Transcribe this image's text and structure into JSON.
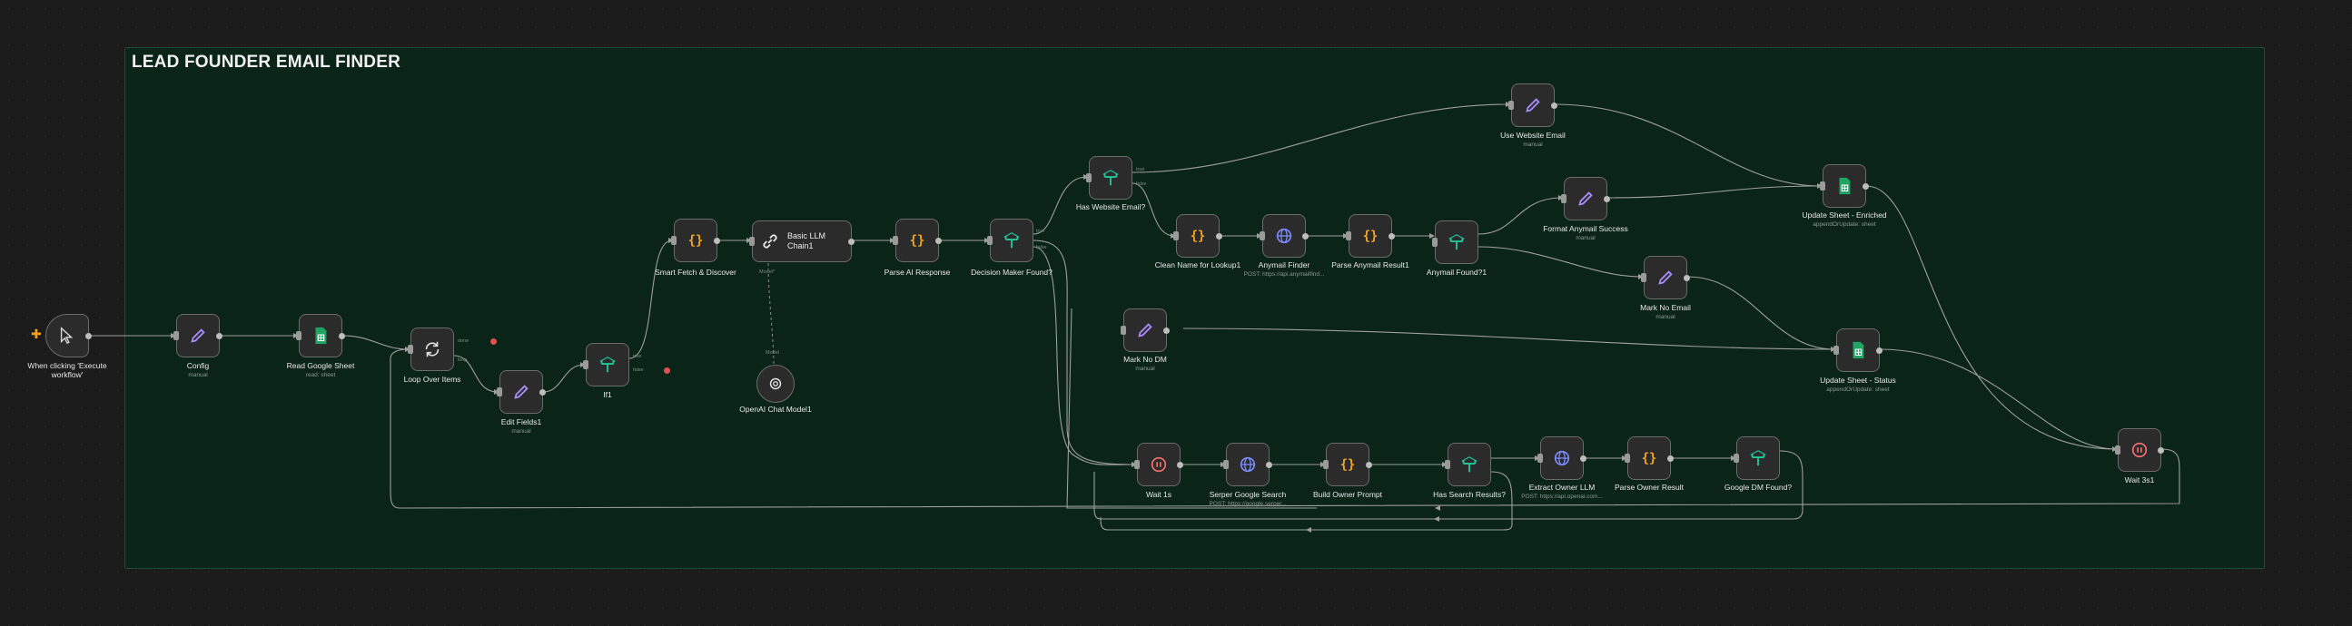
{
  "workflow": {
    "title": "LEAD FOUNDER EMAIL FINDER"
  },
  "colors": {
    "canvas": "#1b1b1b",
    "group_fill": "#0b2418",
    "node_fill": "#2b2b2b",
    "wire": "#9e9e9e",
    "pencil": "#a78bfa",
    "code": "#f5a623",
    "sheets": "#20a464",
    "http": "#7c8cff"
  },
  "nodes": {
    "trigger": {
      "label": "When clicking 'Execute workflow'",
      "icon": "cursor-icon"
    },
    "config": {
      "label": "Config",
      "sub": "manual",
      "icon": "pencil-icon"
    },
    "read_sheet": {
      "label": "Read Google Sheet",
      "sub": "read: sheet",
      "icon": "sheets-icon"
    },
    "loop": {
      "label": "Loop Over Items",
      "icon": "loop-icon",
      "out_a": "done",
      "out_b": "loop"
    },
    "edit_fields": {
      "label": "Edit Fields1",
      "sub": "manual",
      "icon": "pencil-icon"
    },
    "if1": {
      "label": "If1",
      "icon": "if-icon",
      "out_a": "true",
      "out_b": "false"
    },
    "smart_fetch": {
      "label": "Smart Fetch & Discover",
      "icon": "code-icon"
    },
    "llm_chain": {
      "label": "Basic LLM Chain1",
      "icon": "link-icon",
      "model_port": "Model*"
    },
    "chat_model": {
      "label": "OpenAI Chat Model1",
      "icon": "openai-icon",
      "port": "Model"
    },
    "parse_ai": {
      "label": "Parse AI Response",
      "icon": "code-icon"
    },
    "decision": {
      "label": "Decision Maker Found?",
      "icon": "if-icon",
      "out_a": "true",
      "out_b": "false"
    },
    "has_website": {
      "label": "Has Website Email?",
      "icon": "if-icon",
      "out_a": "true",
      "out_b": "false"
    },
    "use_website": {
      "label": "Use Website Email",
      "sub": "manual",
      "icon": "pencil-icon"
    },
    "clean_name": {
      "label": "Clean Name for Lookup1",
      "icon": "code-icon"
    },
    "anymail_finder": {
      "label": "Anymail Finder",
      "sub": "POST: https://api.anymailfind...",
      "icon": "globe-icon"
    },
    "parse_anymail": {
      "label": "Parse Anymail Result1",
      "icon": "code-icon"
    },
    "anymail_found": {
      "label": "Anymail Found?1",
      "icon": "if-icon"
    },
    "format_anymail": {
      "label": "Format Anymail Success",
      "sub": "manual",
      "icon": "pencil-icon"
    },
    "mark_no_email": {
      "label": "Mark No Email",
      "sub": "manual",
      "icon": "pencil-icon"
    },
    "update_enriched": {
      "label": "Update Sheet - Enriched",
      "sub": "appendOrUpdate: sheet",
      "icon": "sheets-icon"
    },
    "update_status": {
      "label": "Update Sheet - Status",
      "sub": "appendOrUpdate: sheet",
      "icon": "sheets-icon"
    },
    "mark_no_dm": {
      "label": "Mark No DM",
      "sub": "manual",
      "icon": "pencil-icon"
    },
    "wait1": {
      "label": "Wait 1s",
      "icon": "pause-icon"
    },
    "serper": {
      "label": "Serper Google Search",
      "sub": "POST: https://google.serper...",
      "icon": "globe-icon"
    },
    "build_owner": {
      "label": "Build Owner Prompt",
      "icon": "code-icon"
    },
    "has_search": {
      "label": "Has Search Results?",
      "icon": "if-icon"
    },
    "extract_owner": {
      "label": "Extract Owner LLM",
      "sub": "POST: https://api.openai.com...",
      "icon": "globe-icon"
    },
    "parse_owner": {
      "label": "Parse Owner Result",
      "icon": "code-icon"
    },
    "google_dm": {
      "label": "Google DM Found?",
      "icon": "if-icon"
    },
    "wait3": {
      "label": "Wait 3s1",
      "icon": "pause-icon"
    }
  }
}
